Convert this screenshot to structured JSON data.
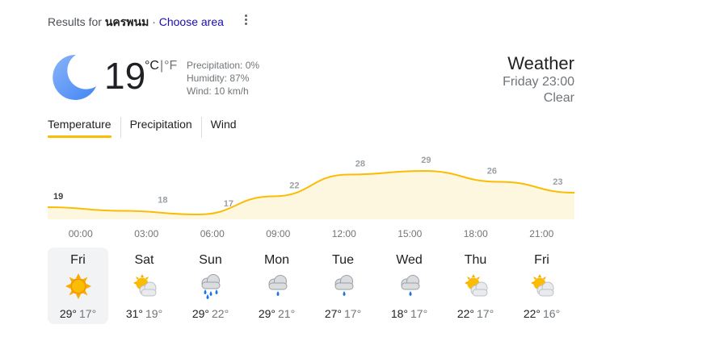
{
  "header": {
    "results_prefix": "Results for",
    "location": "นครพนม",
    "separator": "·",
    "choose_area": "Choose area"
  },
  "current": {
    "icon": "moon-icon",
    "temperature": "19",
    "unit_c": "°C",
    "unit_sep": "|",
    "unit_f": "°F",
    "precipitation": "Precipitation: 0%",
    "humidity": "Humidity: 87%",
    "wind": "Wind: 10 km/h",
    "title": "Weather",
    "time": "Friday 23:00",
    "condition": "Clear"
  },
  "tabs": [
    {
      "label": "Temperature",
      "active": true
    },
    {
      "label": "Precipitation",
      "active": false
    },
    {
      "label": "Wind",
      "active": false
    }
  ],
  "chart_data": {
    "type": "area",
    "x": [
      "23:00",
      "02:00",
      "05:00",
      "08:00",
      "11:00",
      "14:00",
      "17:00",
      "20:00"
    ],
    "values": [
      19,
      18,
      17,
      22,
      28,
      29,
      26,
      23
    ],
    "xticks": [
      "00:00",
      "03:00",
      "06:00",
      "09:00",
      "12:00",
      "15:00",
      "18:00",
      "21:00"
    ],
    "line_color": "#fbbc04",
    "fill_color": "#fef7e0",
    "legend": "none",
    "grid": false
  },
  "days": [
    {
      "name": "Fri",
      "icon": "sunny-icon",
      "high": "29°",
      "low": "17°",
      "selected": true
    },
    {
      "name": "Sat",
      "icon": "partly-cloudy-icon",
      "high": "31°",
      "low": "19°",
      "selected": false
    },
    {
      "name": "Sun",
      "icon": "rain-storm-icon",
      "high": "29°",
      "low": "22°",
      "selected": false
    },
    {
      "name": "Mon",
      "icon": "rain-icon",
      "high": "29°",
      "low": "21°",
      "selected": false
    },
    {
      "name": "Tue",
      "icon": "rain-icon",
      "high": "27°",
      "low": "17°",
      "selected": false
    },
    {
      "name": "Wed",
      "icon": "rain-icon",
      "high": "18°",
      "low": "17°",
      "selected": false
    },
    {
      "name": "Thu",
      "icon": "partly-cloudy-icon",
      "high": "22°",
      "low": "17°",
      "selected": false
    },
    {
      "name": "Fri",
      "icon": "partly-cloudy-icon",
      "high": "22°",
      "low": "16°",
      "selected": false
    }
  ]
}
